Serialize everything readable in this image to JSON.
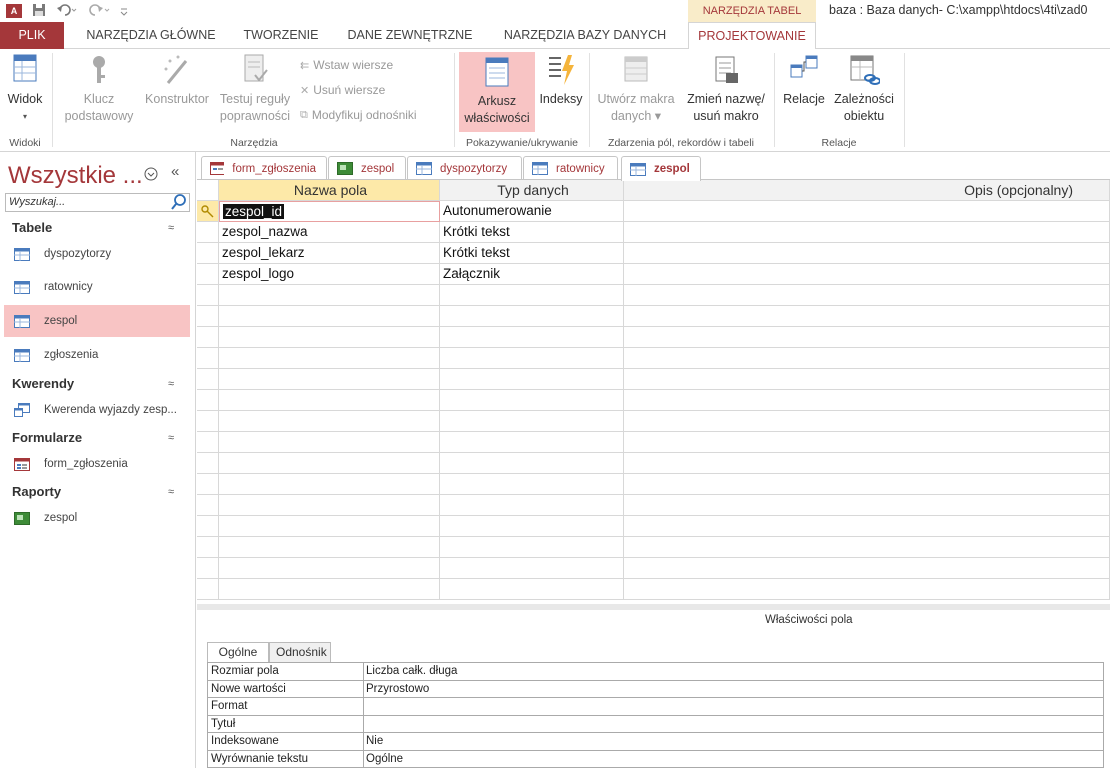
{
  "window": {
    "title": "baza : Baza danych- C:\\xampp\\htdocs\\4ti\\zad0",
    "context_label": "NARZĘDZIA TABEL",
    "app_icon_text": "A"
  },
  "ribbon_tabs": [
    "PLIK",
    "NARZĘDZIA GŁÓWNE",
    "TWORZENIE",
    "DANE ZEWNĘTRZNE",
    "NARZĘDZIA BAZY DANYCH",
    "PROJEKTOWANIE"
  ],
  "ribbon": {
    "widok": {
      "label": "Widok",
      "group": "Widoki"
    },
    "klucz": {
      "line1": "Klucz",
      "line2": "podstawowy"
    },
    "konstruktor": {
      "label": "Konstruktor"
    },
    "testuj": {
      "line1": "Testuj reguły",
      "line2": "poprawności"
    },
    "wstaw": "Wstaw wiersze",
    "usun": "Usuń wiersze",
    "modyfikuj": "Modyfikuj odnośniki",
    "narzedzia_group": "Narzędzia",
    "arkusz": {
      "line1": "Arkusz",
      "line2": "właściwości"
    },
    "indeksy": "Indeksy",
    "pokazywanie_group": "Pokazywanie/ukrywanie",
    "utworz": {
      "line1": "Utwórz makra",
      "line2": "danych"
    },
    "zmien": {
      "line1": "Zmień nazwę/",
      "line2": "usuń makro"
    },
    "zdarzenia_group": "Zdarzenia pól, rekordów i tabeli",
    "relacje": "Relacje",
    "zaleznosci": {
      "line1": "Zależności",
      "line2": "obiektu"
    },
    "relacje_group": "Relacje"
  },
  "nav": {
    "title": "Wszystkie ...",
    "search_placeholder": "Wyszukaj...",
    "sections": [
      {
        "name": "Tabele",
        "items": [
          "dyspozytorzy",
          "ratownicy",
          "zespol",
          "zgłoszenia"
        ]
      },
      {
        "name": "Kwerendy",
        "items": [
          "Kwerenda wyjazdy zesp..."
        ]
      },
      {
        "name": "Formularze",
        "items": [
          "form_zgłoszenia"
        ]
      },
      {
        "name": "Raporty",
        "items": [
          "zespol"
        ]
      }
    ],
    "selected": "zespol"
  },
  "doc_tabs": [
    "form_zgłoszenia",
    "zespol",
    "dyspozytorzy",
    "ratownicy",
    "zespol"
  ],
  "design_grid": {
    "headers": [
      "Nazwa pola",
      "Typ danych",
      "Opis (opcjonalny)"
    ],
    "rows": [
      {
        "field": "zespol_id",
        "type": "Autonumerowanie",
        "desc": ""
      },
      {
        "field": "zespol_nazwa",
        "type": "Krótki tekst",
        "desc": ""
      },
      {
        "field": "zespol_lekarz",
        "type": "Krótki tekst",
        "desc": ""
      },
      {
        "field": "zespol_logo",
        "type": "Załącznik",
        "desc": ""
      }
    ]
  },
  "properties": {
    "label": "Właściwości pola",
    "tabs": [
      "Ogólne",
      "Odnośnik"
    ],
    "rows": [
      {
        "key": "Rozmiar pola",
        "value": "Liczba całk. długa"
      },
      {
        "key": "Nowe wartości",
        "value": "Przyrostowo"
      },
      {
        "key": "Format",
        "value": ""
      },
      {
        "key": "Tytuł",
        "value": ""
      },
      {
        "key": "Indeksowane",
        "value": "Nie"
      },
      {
        "key": "Wyrównanie tekstu",
        "value": "Ogólne"
      }
    ]
  },
  "colors": {
    "accent": "#a4373a",
    "selected": "#f8c4c4",
    "context_bg": "#f9ecc9",
    "header_bg": "#f2f2f2"
  }
}
